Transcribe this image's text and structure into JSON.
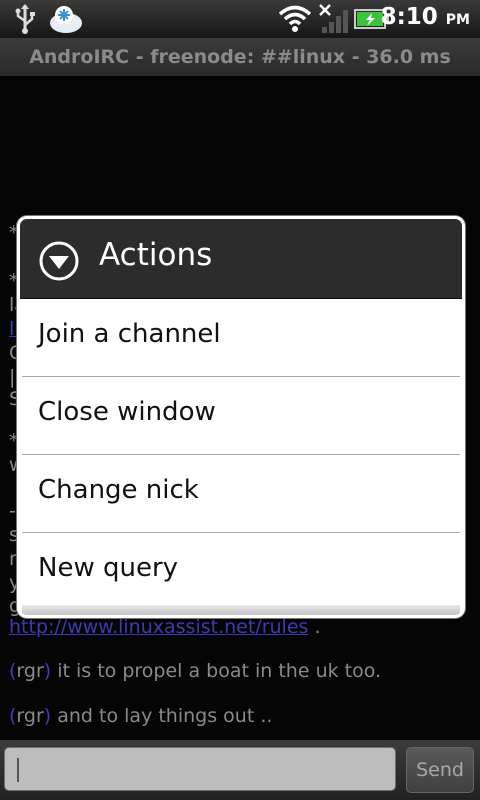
{
  "status_bar": {
    "time": "8:10",
    "ampm": "PM",
    "icons": [
      "usb-icon",
      "app-notification-icon",
      "wifi-icon",
      "no-signal-icon",
      "battery-charging-icon"
    ]
  },
  "title_bar": {
    "title": "AndroIRC - freenode: ##linux - 36.0 ms"
  },
  "chat": {
    "fragments_left": [
      "*",
      "*",
      "la",
      "li",
      "C",
      "|",
      "S",
      "*",
      "w",
      "-(",
      "s",
      "r",
      "y",
      "g"
    ],
    "fragment_right": ")",
    "link_line": {
      "url": "http://www.linuxassist.net/rules",
      "suffix": " ."
    },
    "messages": [
      {
        "open": "(",
        "nick": "rgr",
        "close": ")",
        "text": " it is to propel a boat in the uk too."
      },
      {
        "open": "(",
        "nick": "rgr",
        "close": ")",
        "text": " and to lay things out .."
      }
    ]
  },
  "dialog": {
    "title": "Actions",
    "items": [
      "Join a channel",
      "Close window",
      "Change nick",
      "New query"
    ]
  },
  "input_bar": {
    "value": "",
    "send_label": "Send"
  },
  "colors": {
    "link": "#3b3bb5",
    "dialog_header": "#2c2c2c",
    "battery_green": "#3cc23c"
  }
}
